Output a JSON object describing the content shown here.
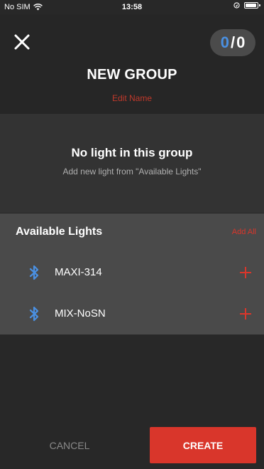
{
  "status_bar": {
    "carrier": "No SIM",
    "time": "13:58"
  },
  "header": {
    "selected_count": "0",
    "separator": "/",
    "total_count": "0",
    "title": "NEW GROUP",
    "edit_name": "Edit Name"
  },
  "empty_group": {
    "title": "No light in this group",
    "subtitle": "Add new light from \"Available Lights\""
  },
  "available": {
    "title": "Available Lights",
    "add_all": "Add All",
    "lights": [
      {
        "name": "MAXI-314"
      },
      {
        "name": "MIX-NoSN"
      }
    ]
  },
  "footer": {
    "cancel": "CANCEL",
    "create": "CREATE"
  },
  "colors": {
    "accent": "#d9362b",
    "bluetooth": "#4a90e2",
    "counter_selected": "#4a90e2"
  },
  "icons": [
    "wifi-icon",
    "location-icon",
    "battery-icon",
    "close-icon",
    "bluetooth-icon",
    "plus-icon"
  ]
}
